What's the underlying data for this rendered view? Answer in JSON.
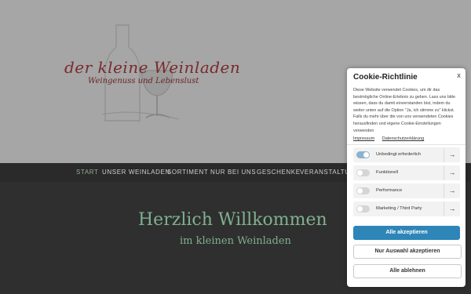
{
  "logo": {
    "title": "der kleine Weinladen",
    "subtitle": "Weingenuss und Lebenslust"
  },
  "nav": {
    "items": [
      {
        "label": "START",
        "active": true
      },
      {
        "label": "UNSER WEINLADEN",
        "active": false
      },
      {
        "label": "SORTIMENT",
        "active": false
      },
      {
        "label": "NUR BEI UNS",
        "active": false
      },
      {
        "label": "GESCHENKE",
        "active": false
      },
      {
        "label": "VERANSTALTUNGEN",
        "active": false
      }
    ]
  },
  "hero": {
    "title": "Herzlich Willkommen",
    "subtitle": "im kleinen Weinladen"
  },
  "cookie": {
    "title": "Cookie-Richtlinie",
    "close_label": "x",
    "description": "Diese Website verwendet Cookies, um dir das bestmögliche Online-Erlebnis zu geben. Lass uns bitte wissen, dass du damit einverstanden bist, indem du weiter unten auf die Option \"Ja, ich stimme zu\" klickst. Falls du mehr über die von uns verwendeten Cookies herausfinden und eigene Cookie-Einstellungen verwenden",
    "links": [
      "Impressum",
      "Datenschutzerklärung"
    ],
    "options": [
      {
        "label": "Unbedingt erforderlich",
        "enabled": true
      },
      {
        "label": "Funktionell",
        "enabled": false
      },
      {
        "label": "Performance",
        "enabled": false
      },
      {
        "label": "Marketing / Third Party",
        "enabled": false
      }
    ],
    "arrow_glyph": "→",
    "accept_all": "Alle akzeptieren",
    "accept_selection": "Nur Auswahl akzeptieren",
    "reject_all": "Alle ablehnen"
  },
  "colors": {
    "header_bg": "#a6a6a6",
    "nav_bg": "#2a2a2a",
    "main_bg": "#2f2f2f",
    "accent_green": "#7fb08f",
    "wine_red": "#7a2a2a",
    "button_blue": "#2e86b8"
  }
}
